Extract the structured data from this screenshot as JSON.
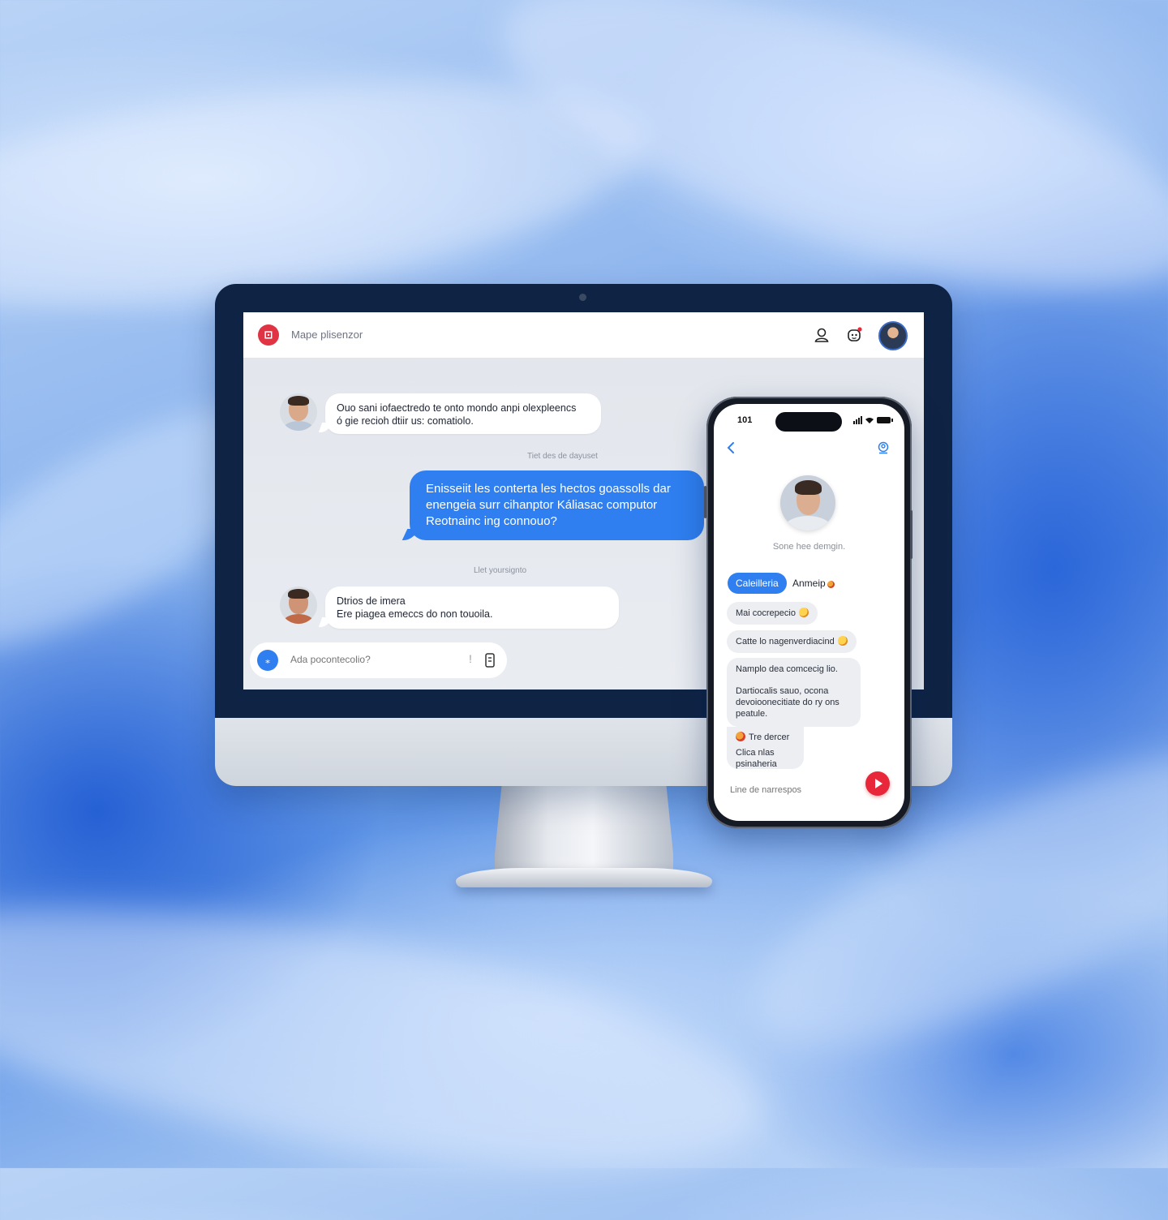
{
  "desktop": {
    "app_title": "Mape plisenzor",
    "app_logo_glyph": "⊡",
    "messages": [
      {
        "direction": "incoming",
        "lines": [
          "Ouo sani iofaectredo te onto mondo anpi olexpleencs",
          "ó gie recioh dtiir us: comatiolo."
        ]
      },
      {
        "direction": "timestamp",
        "text": "Tiet des de dayuset"
      },
      {
        "direction": "outgoing",
        "lines": [
          "Enisseiit les conterta les hectos goassolls dar",
          "enengeia surr cihanptor Káliasac computor",
          "Reotnainc ing connouo?"
        ]
      },
      {
        "direction": "timestamp",
        "text": "Llet yoursignto"
      },
      {
        "direction": "incoming",
        "lines": [
          "Dtrios de imera",
          "Ere piagea emeccs do non touoila."
        ]
      }
    ],
    "composer": {
      "placeholder": "Ada pocontecolio?",
      "button_glyph": "⁎",
      "extra_glyph": "!"
    },
    "icons": [
      "user-icon",
      "bot-icon",
      "avatar"
    ]
  },
  "phone": {
    "status_time": "101",
    "profile_name": "Sone hee demgin.",
    "chips": {
      "active": "Caleilleria",
      "other": "Anmeip"
    },
    "bubbles": [
      {
        "text": "Mai cocrepecio"
      },
      {
        "text": "Catte lo nagenverdiacind"
      },
      {
        "lines": [
          "Namplo dea comcecig lio.",
          "",
          "Dartiocalis sauo, ocona",
          "devoioonecitiate do ry ons",
          "peatule."
        ]
      },
      {
        "lines": [
          "Tre dercer",
          "",
          "Clica nlas",
          "psinaheria"
        ]
      }
    ],
    "input_placeholder": "Line de narrespos"
  },
  "colors": {
    "accent": "#2f7ff0",
    "danger": "#e8283a",
    "bezel": "#0f2444"
  }
}
